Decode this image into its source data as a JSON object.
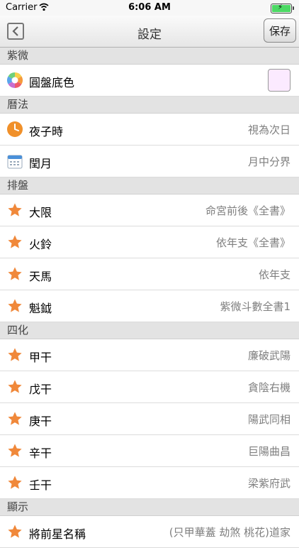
{
  "status_bar": {
    "carrier": "Carrier",
    "time": "6:06 AM"
  },
  "nav": {
    "title": "設定",
    "save_label": "保存"
  },
  "sections": [
    {
      "header": "紫微",
      "rows": [
        {
          "label": "圓盤底色",
          "icon": "color-wheel-icon",
          "swatch_color": "#fbeaff"
        }
      ]
    },
    {
      "header": "曆法",
      "rows": [
        {
          "label": "夜子時",
          "value": "視為次日",
          "icon": "clock-icon"
        },
        {
          "label": "閏月",
          "value": "月中分界",
          "icon": "calendar-icon"
        }
      ]
    },
    {
      "header": "排盤",
      "rows": [
        {
          "label": "大限",
          "value": "命宮前後《全書》",
          "icon": "star-icon"
        },
        {
          "label": "火鈴",
          "value": "依年支《全書》",
          "icon": "star-icon"
        },
        {
          "label": "天馬",
          "value": "依年支",
          "icon": "star-icon"
        },
        {
          "label": "魁鉞",
          "value": "紫微斗數全書1",
          "icon": "star-icon"
        }
      ]
    },
    {
      "header": "四化",
      "rows": [
        {
          "label": "甲干",
          "value": "廉破武陽",
          "icon": "star-icon"
        },
        {
          "label": "戊干",
          "value": "貪陰右機",
          "icon": "star-icon"
        },
        {
          "label": "庚干",
          "value": "陽武同相",
          "icon": "star-icon"
        },
        {
          "label": "辛干",
          "value": "巨陽曲昌",
          "icon": "star-icon"
        },
        {
          "label": "壬干",
          "value": "梁紫府武",
          "icon": "star-icon"
        }
      ]
    },
    {
      "header": "顯示",
      "rows": [
        {
          "label": "將前星名稱",
          "value": "(只甲華蓋 劫煞 桃花)道家",
          "icon": "star-icon"
        }
      ]
    }
  ],
  "colors": {
    "star": "#f0883a",
    "clock": "#f0902a",
    "battery": "#4cd964"
  }
}
